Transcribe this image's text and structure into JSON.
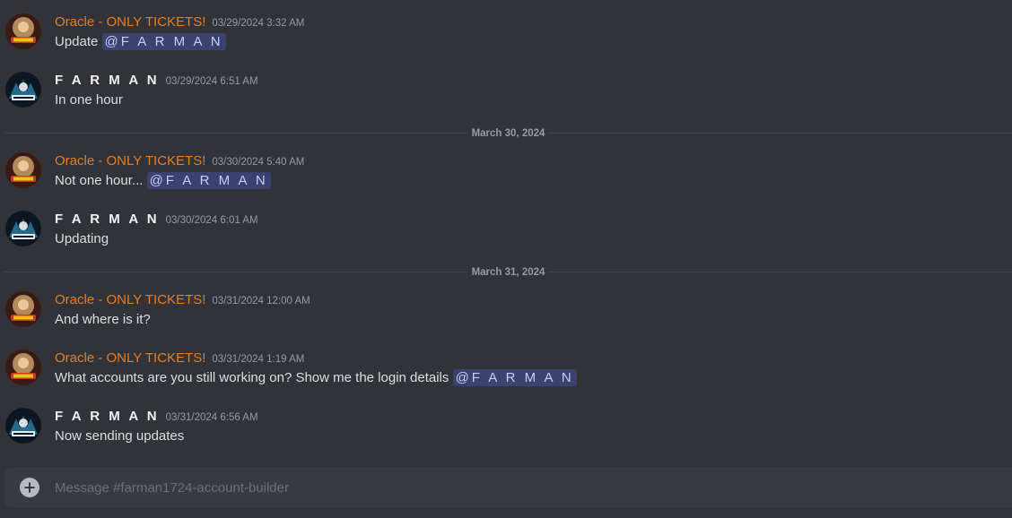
{
  "channel": {
    "composer_placeholder": "Message #farman1724-account-builder"
  },
  "users": {
    "oracle": {
      "name": "Oracle - ONLY TICKETS!",
      "color": "#e67e22"
    },
    "farman": {
      "name": "F A R M A N",
      "color": "#f2f3f5"
    }
  },
  "messages": [
    {
      "author": "Oracle - ONLY TICKETS!",
      "timestamp": "03/29/2024 3:32 AM",
      "text": "Update",
      "mention": "@F A R M A N"
    },
    {
      "author": "F A R M A N",
      "timestamp": "03/29/2024 6:51 AM",
      "text": "In one hour"
    },
    {
      "author": "Oracle - ONLY TICKETS!",
      "timestamp": "03/30/2024 5:40 AM",
      "text": "Not one hour...",
      "mention": "@F A R M A N"
    },
    {
      "author": "F A R M A N",
      "timestamp": "03/30/2024 6:01 AM",
      "text": "Updating"
    },
    {
      "author": "Oracle - ONLY TICKETS!",
      "timestamp": "03/31/2024 12:00 AM",
      "text": "And where is it?"
    },
    {
      "author": "Oracle - ONLY TICKETS!",
      "timestamp": "03/31/2024 1:19 AM",
      "text": "What accounts are you still working on? Show me the login details",
      "mention": "@F A R M A N"
    },
    {
      "author": "F A R M A N",
      "timestamp": "03/31/2024 6:56 AM",
      "text": "Now sending updates"
    }
  ],
  "dividers": [
    "March 30, 2024",
    "March 31, 2024"
  ],
  "icons": {
    "oracle_avatar": "oracle-avatar-icon",
    "farman_avatar": "farman-avatar-icon",
    "add": "plus-circle-icon"
  }
}
